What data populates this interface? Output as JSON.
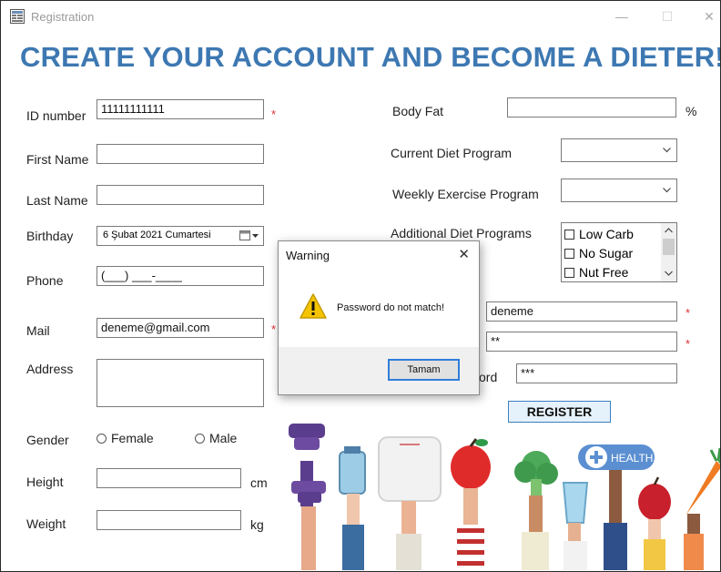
{
  "window": {
    "title": "Registration",
    "minimize_glyph": "—",
    "maximize_glyph": "☐",
    "close_glyph": "✕"
  },
  "heading": "CREATE YOUR ACCOUNT AND BECOME A DIETER!",
  "left_form": {
    "id_label": "ID number",
    "id_value": "11111111111",
    "required_mark": "*",
    "first_name_label": "First Name",
    "first_name_value": "",
    "last_name_label": "Last Name",
    "last_name_value": "",
    "birthday_label": "Birthday",
    "birthday_value": "6  Şubat  2021 Cumartesi",
    "phone_label": "Phone",
    "phone_value": "(___) ___-____",
    "mail_label": "Mail",
    "mail_value": "deneme@gmail.com",
    "address_label": "Address",
    "address_value": "",
    "gender_label": "Gender",
    "gender_female": "Female",
    "gender_male": "Male",
    "height_label": "Height",
    "height_value": "",
    "height_unit": "cm",
    "weight_label": "Weight",
    "weight_value": "",
    "weight_unit": "kg"
  },
  "right_form": {
    "body_fat_label": "Body Fat",
    "body_fat_value": "",
    "body_fat_unit": "%",
    "current_diet_label": "Current Diet Program",
    "current_diet_value": "",
    "weekly_exercise_label": "Weekly Exercise Program",
    "weekly_exercise_value": "",
    "additional_label": "Additional Diet Programs",
    "additional_options": [
      "Low Carb",
      "No Sugar",
      "Nut Free"
    ],
    "username_value": "deneme",
    "password_value": "**",
    "confirm_label_partial": "ord",
    "confirm_value": "***",
    "register_label": "REGISTER"
  },
  "dialog": {
    "title": "Warning",
    "close_glyph": "✕",
    "message": "Password do not match!",
    "ok_label": "Tamam"
  },
  "illustration": {
    "health_label": "HEALTH"
  },
  "colors": {
    "heading": "#3d78b2",
    "required": "#e03030",
    "button_border": "#3c7fc0",
    "button_fill": "#e5f1fb",
    "dialog_focus": "#2f7ed8"
  }
}
